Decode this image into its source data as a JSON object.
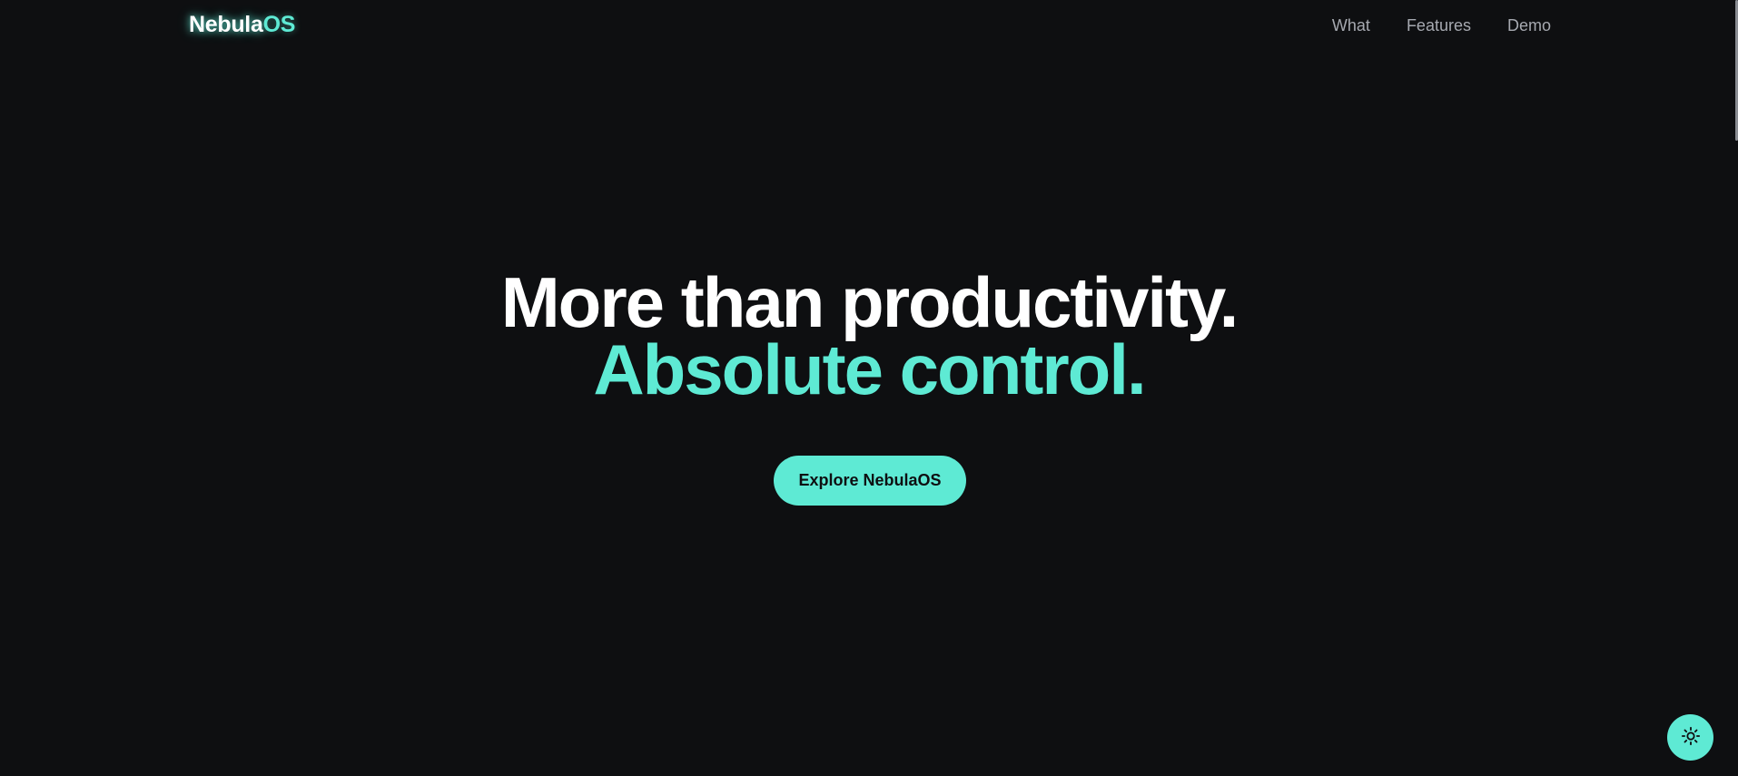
{
  "nav": {
    "brand_main": "Nebula",
    "brand_accent": "OS",
    "links": [
      "What",
      "Features",
      "Demo"
    ]
  },
  "hero": {
    "line1": "More than productivity.",
    "line2": "Absolute control."
  },
  "cta": {
    "label": "Explore NebulaOS"
  },
  "theme_toggle": {
    "icon": "sun-icon"
  },
  "colors": {
    "background": "#0e0f11",
    "accent": "#5eead4",
    "text": "#ffffff",
    "nav_text": "#a6a9b0"
  }
}
